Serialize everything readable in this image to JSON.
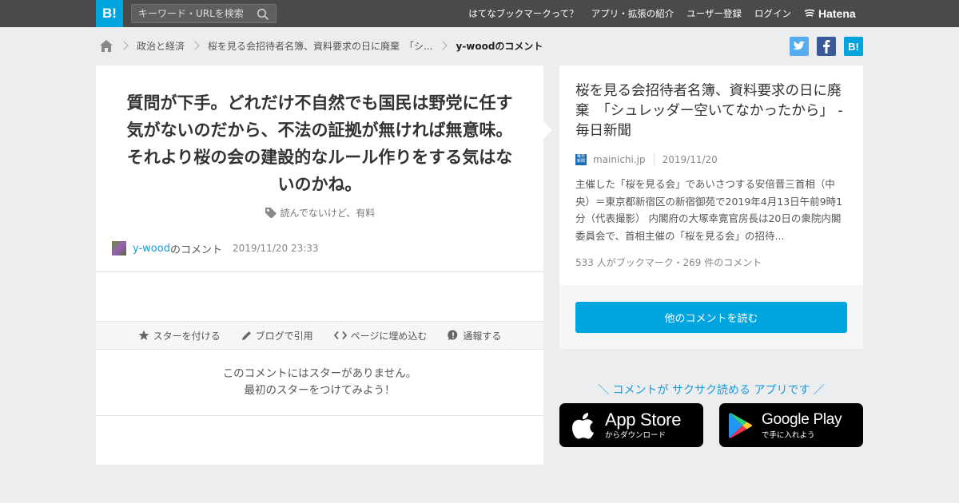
{
  "topbar": {
    "logo": "B!",
    "search_placeholder": "キーワード・URLを検索",
    "nav": [
      "はてなブックマークって？",
      "アプリ・拡張の紹介",
      "ユーザー登録",
      "ログイン"
    ],
    "brand": "Hatena",
    "color": "#4a4a4a",
    "accent": "#00a4de"
  },
  "breadcrumb": {
    "home_icon": "home-icon",
    "items": [
      "政治と経済",
      "桜を見る会招待者名簿、資料要求の日に廃棄　「シ...",
      "y-woodのコメント"
    ]
  },
  "share": {
    "twitter": "twitter-icon",
    "facebook": "facebook-icon",
    "hatena_label": "B!"
  },
  "comment": {
    "text": "質問が下手。どれだけ不自然でも国民は野党に任す気がないのだから、不法の証拠が無ければ無意味。それより桜の会の建設的なルール作りをする気はないのかね。",
    "tags": "読んでないけど、有料",
    "user": "y-wood",
    "user_suffix": "のコメント",
    "date": "2019/11/20 23:33"
  },
  "actions": {
    "star": "スターを付ける",
    "blog": "ブログで引用",
    "embed": "ページに埋め込む",
    "report": "通報する"
  },
  "stars": {
    "line1": "このコメントにはスターがありません。",
    "line2": "最初のスターをつけてみよう！"
  },
  "entry": {
    "title": "桜を見る会招待者名簿、資料要求の日に廃棄　「シュレッダー空いてなかったから」 - 毎日新聞",
    "favicon_text": "毎日新聞",
    "domain": "mainichi.jp",
    "date": "2019/11/20",
    "summary": "主催した「桜を見る会」であいさつする安倍晋三首相（中央）＝東京都新宿区の新宿御苑で2019年4月13日午前9時1分（代表撮影） 内閣府の大塚幸寛官房長は20日の衆院内閣委員会で、首相主催の「桜を見る会」の招待...",
    "counts": "533 人がブックマーク・269 件のコメント",
    "read_button": "他のコメントを読む"
  },
  "app": {
    "promo": "＼ コメントが サクサク読める アプリです ／",
    "appstore_big": "App Store",
    "appstore_small": "からダウンロード",
    "googleplay_big": "Google Play",
    "googleplay_small": "で手に入れよう"
  }
}
